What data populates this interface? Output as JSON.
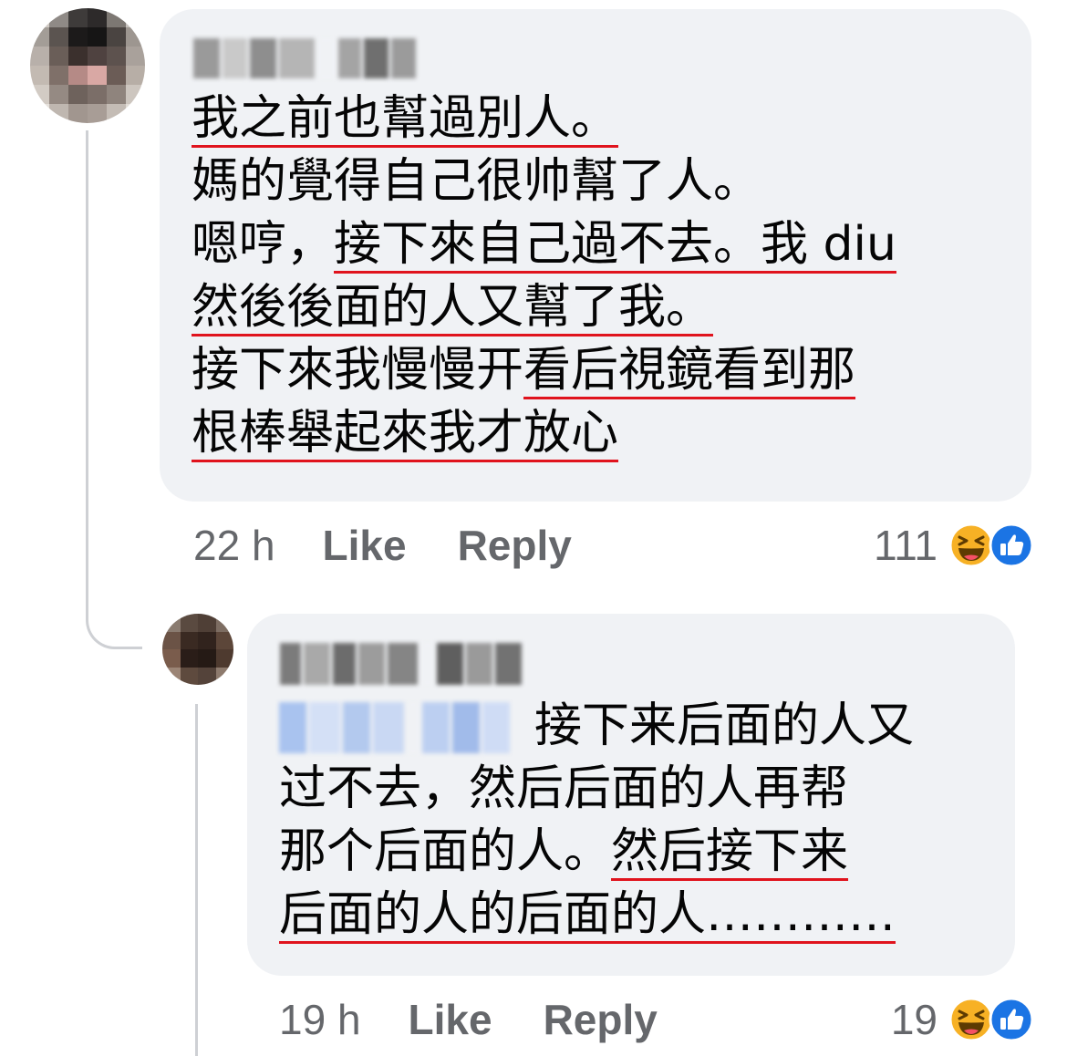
{
  "colors": {
    "bubble": "#f0f2f5",
    "underline": "#e0131d",
    "meta_text": "#65676b",
    "like_blue": "#1b74e4",
    "haha_yellow": "#f7b125"
  },
  "comment_1": {
    "author_name": "Kace 林",
    "author_visibility": "pixelated",
    "text_lines": {
      "l1": "我之前也幫過別人。",
      "l2": "媽的覺得自己很帅幫了人。",
      "l3a": "嗯哼，",
      "l3b": "接下來自己過不去。我 diu",
      "l4": "然後後面的人又幫了我。",
      "l5a": "接下來我慢慢开",
      "l5b": "看后視鏡看到那",
      "l6": "根棒舉起來我才放心"
    },
    "time": "22 h",
    "like_label": "Like",
    "reply_label": "Reply",
    "reaction_count": "111",
    "reaction_icons": [
      "haha-icon",
      "like-icon"
    ]
  },
  "comment_2": {
    "author_name": "Abigail Lim",
    "author_visibility": "pixelated",
    "mention_visibility": "pixelated",
    "text_lines": {
      "l1": "接下来后面的人又",
      "l2": "过不去，然后后面的人再帮",
      "l3a": "那个后面的人。",
      "l3b": "然后接下来",
      "l4": "后面的人的后面的人…………"
    },
    "time": "19 h",
    "like_label": "Like",
    "reply_label": "Reply",
    "reaction_count": "19",
    "reaction_icons": [
      "haha-icon",
      "like-icon"
    ]
  }
}
